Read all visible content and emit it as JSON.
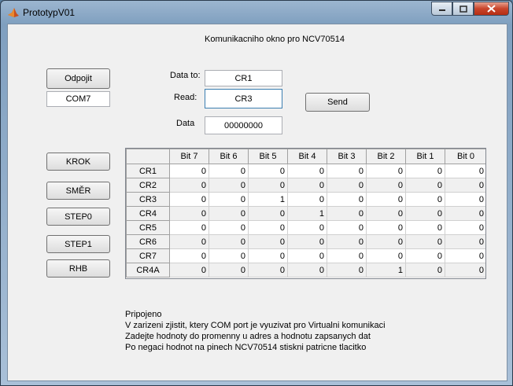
{
  "window": {
    "title": "PrototypV01",
    "icon": "matlab-icon",
    "buttons": {
      "minimize": "minimize-icon",
      "maximize": "maximize-icon",
      "close": "close-icon"
    }
  },
  "header": {
    "title": "Komunikacniho okno pro NCV70514"
  },
  "connection": {
    "disconnect_label": "Odpojit",
    "port": "COM7"
  },
  "fields": {
    "data_to_label": "Data to:",
    "data_to_value": "CR1",
    "read_label": "Read:",
    "read_value": "CR3",
    "data_label": "Data",
    "data_value": "00000000",
    "send_label": "Send"
  },
  "actions": [
    "KROK",
    "SMĚR",
    "STEP0",
    "STEP1",
    "RHB"
  ],
  "table": {
    "columns": [
      "Bit 7",
      "Bit 6",
      "Bit 5",
      "Bit 4",
      "Bit 3",
      "Bit 2",
      "Bit 1",
      "Bit 0"
    ],
    "rows": [
      {
        "name": "CR1",
        "values": [
          0,
          0,
          0,
          0,
          0,
          0,
          0,
          0
        ]
      },
      {
        "name": "CR2",
        "values": [
          0,
          0,
          0,
          0,
          0,
          0,
          0,
          0
        ]
      },
      {
        "name": "CR3",
        "values": [
          0,
          0,
          1,
          0,
          0,
          0,
          0,
          0
        ]
      },
      {
        "name": "CR4",
        "values": [
          0,
          0,
          0,
          1,
          0,
          0,
          0,
          0
        ]
      },
      {
        "name": "CR5",
        "values": [
          0,
          0,
          0,
          0,
          0,
          0,
          0,
          0
        ]
      },
      {
        "name": "CR6",
        "values": [
          0,
          0,
          0,
          0,
          0,
          0,
          0,
          0
        ]
      },
      {
        "name": "CR7",
        "values": [
          0,
          0,
          0,
          0,
          0,
          0,
          0,
          0
        ]
      },
      {
        "name": "CR4A",
        "values": [
          0,
          0,
          0,
          0,
          0,
          1,
          0,
          0
        ]
      }
    ]
  },
  "status": {
    "lines": [
      "Pripojeno",
      "V zarizeni zjistit, ktery COM port je vyuzivat pro Virtualni komunikaci",
      "Zadejte hodnoty do promenny u adres a hodnotu zapsanych dat",
      "Po negaci hodnot na pinech NCV70514 stiskni patricne tlacitko"
    ]
  }
}
